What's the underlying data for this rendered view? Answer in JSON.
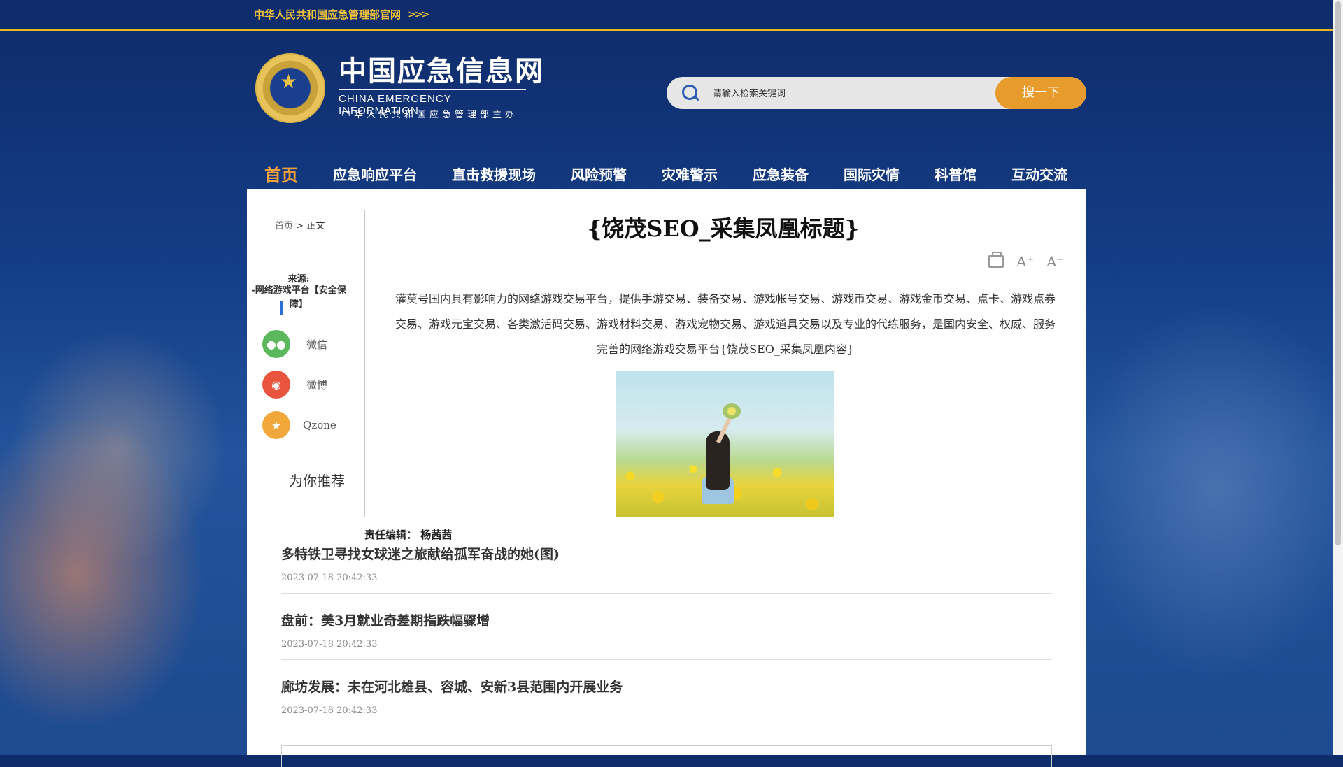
{
  "header": {
    "gov_link": "中华人民共和国应急管理部官网",
    "gov_arrows": ">>>",
    "logo_title": "中国应急信息网",
    "logo_en": "CHINA EMERGENCY INFORMATION",
    "logo_host": "中华人民共和国应急管理部主办",
    "search_placeholder": "请输入检索关键词",
    "search_button": "搜一下"
  },
  "nav": {
    "items": [
      {
        "label": "首页",
        "active": true
      },
      {
        "label": "应急响应平台"
      },
      {
        "label": "直击救援现场"
      },
      {
        "label": "风险预警"
      },
      {
        "label": "灾难警示"
      },
      {
        "label": "应急装备"
      },
      {
        "label": "国际灾情"
      },
      {
        "label": "科普馆"
      },
      {
        "label": "互动交流"
      }
    ]
  },
  "sidebar": {
    "breadcrumb_home": "首页",
    "breadcrumb_sep": ">",
    "breadcrumb_current": "正文",
    "source_label": "来源:",
    "source_value": "-网络游戏平台【安全保障】",
    "share": [
      {
        "label": "微信",
        "icon": "wechat-icon",
        "color": "#5cb85c"
      },
      {
        "label": "微博",
        "icon": "weibo-icon",
        "color": "#e8543e"
      },
      {
        "label": "Qzone",
        "icon": "qzone-icon",
        "color": "#f2a73b"
      }
    ],
    "recommend_heading": "为你推荐"
  },
  "article": {
    "title": "{饶茂SEO_采集凤凰标题}",
    "font_increase": "A⁺",
    "font_decrease": "A⁻",
    "body": "灌莫号国内具有影响力的网络游戏交易平台，提供手游交易、装备交易、游戏帐号交易、游戏币交易、游戏金币交易、点卡、游戏点券交易、游戏元宝交易、各类激活码交易、游戏材料交易、游戏宠物交易、游戏道具交易以及专业的代练服务，是国内安全、权威、服务完善的网络游戏交易平台{饶茂SEO_采集凤凰内容}",
    "editor_label": "责任编辑：",
    "editor_name": "杨茜茜"
  },
  "recommendations": [
    {
      "title": "多特铁卫寻找女球迷之旅献给孤军奋战的她(图)",
      "date": "2023-07-18 20:42:33"
    },
    {
      "title": "盘前：美3月就业奇差期指跌幅骤增",
      "date": "2023-07-18 20:42:33"
    },
    {
      "title": "廊坊发展：未在河北雄县、容城、安新3县范围内开展业务",
      "date": "2023-07-18 20:42:33"
    }
  ],
  "colors": {
    "accent": "#e89b2d",
    "nav_active": "#f2a13c",
    "gold": "#e8b820",
    "header_bg": "#0f2c6c"
  }
}
